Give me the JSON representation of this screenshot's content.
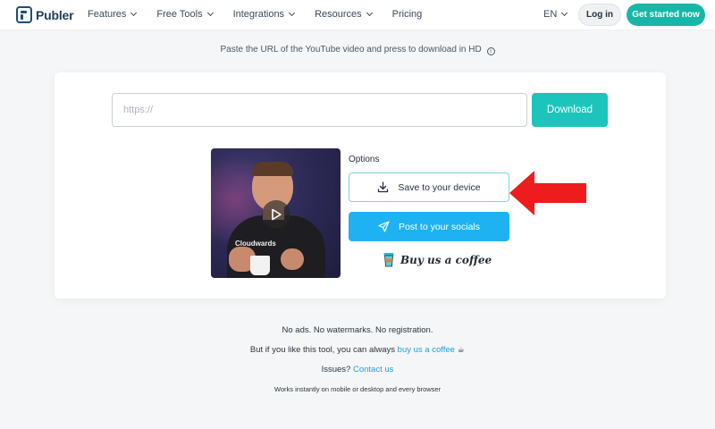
{
  "header": {
    "brand": "Publer",
    "nav": [
      {
        "label": "Features",
        "has_dropdown": true
      },
      {
        "label": "Free Tools",
        "has_dropdown": true
      },
      {
        "label": "Integrations",
        "has_dropdown": true
      },
      {
        "label": "Resources",
        "has_dropdown": true
      },
      {
        "label": "Pricing",
        "has_dropdown": false
      }
    ],
    "language": "EN",
    "login_label": "Log in",
    "get_started_label": "Get started now"
  },
  "subtitle": "Paste the URL of the YouTube video and press to download in HD",
  "form": {
    "url_placeholder": "https://",
    "url_value": "",
    "download_label": "Download"
  },
  "preview": {
    "thumbnail_text": "Cloudwards",
    "options_label": "Options",
    "save_label": "Save to your device",
    "post_label": "Post to your socials",
    "coffee_label": "Buy us a coffee"
  },
  "footer": {
    "line1": "No ads. No watermarks. No registration.",
    "line2_prefix": "But if you like this tool, you can always",
    "line2_link": "buy us a coffee",
    "line3_prefix": "Issues?",
    "line3_link": "Contact us",
    "line4": "Works instantly on mobile or desktop and every browser"
  },
  "colors": {
    "accent_teal": "#16b7a6",
    "download_teal": "#1cc4bc",
    "post_blue": "#1eb2f3",
    "link_blue": "#1d9fe0",
    "arrow_red": "#ee1c1c"
  },
  "icons": [
    "info-icon",
    "download-icon",
    "send-icon",
    "coffee-cup-icon",
    "play-icon",
    "chevron-down-icon"
  ]
}
